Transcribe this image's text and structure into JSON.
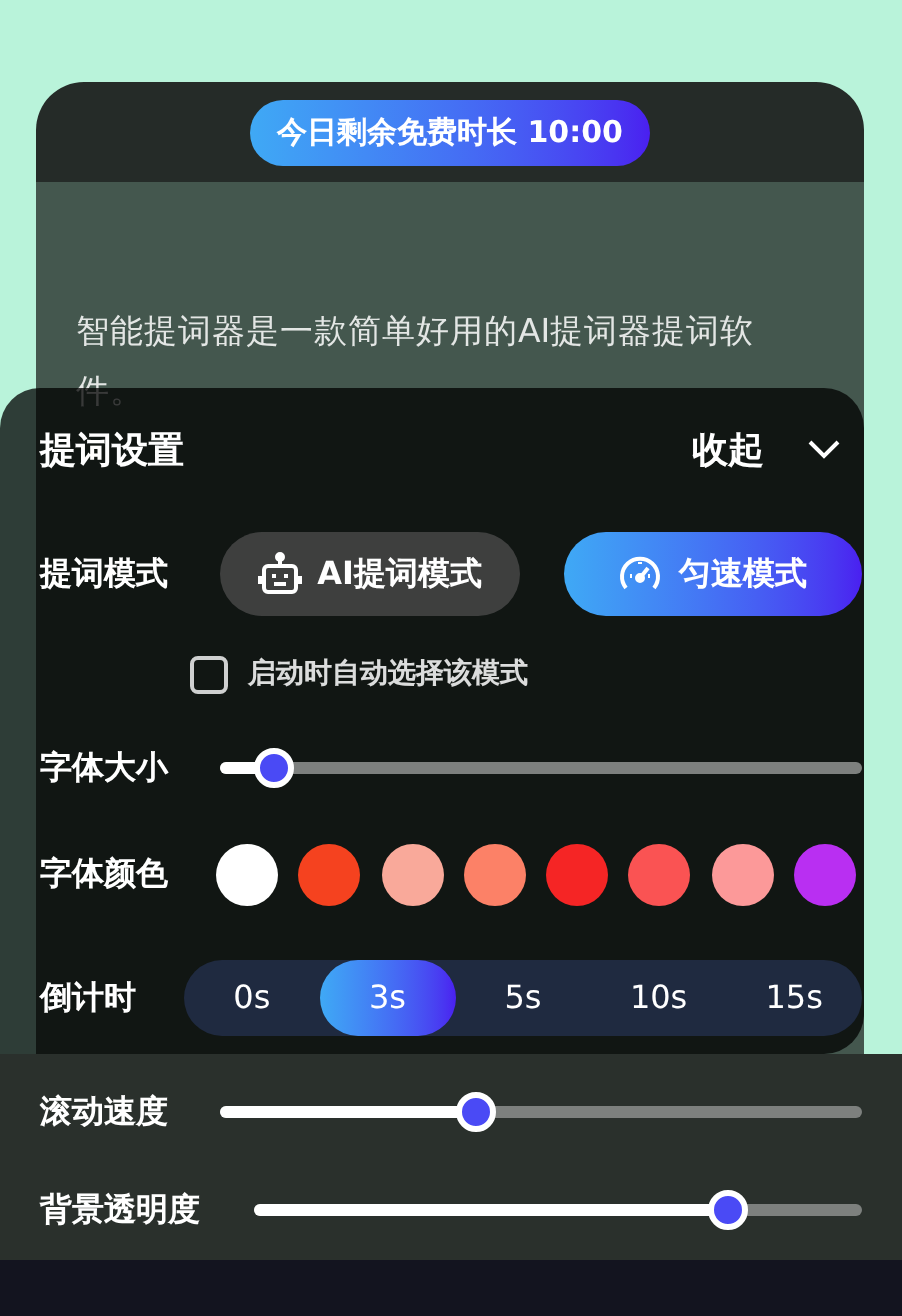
{
  "timer_badge": "今日剩余免费时长 10:00",
  "script_lines": [
    "智能提词器是一款简单好用的AI提词器提词软",
    "件。"
  ],
  "settings": {
    "title": "提词设置",
    "collapse_label": "收起",
    "mode": {
      "label": "提词模式",
      "options": [
        {
          "label": "AI提词模式",
          "kind": "robot",
          "selected": false
        },
        {
          "label": "匀速模式",
          "kind": "speed",
          "selected": true
        }
      ],
      "auto_select": {
        "label": "启动时自动选择该模式",
        "checked": false
      }
    },
    "font_size": {
      "label": "字体大小",
      "level": 0.085
    },
    "font_color": {
      "label": "字体颜色",
      "colors": [
        {
          "color": "#ffffff"
        },
        {
          "color": "#f5421f"
        },
        {
          "color": "#f9a99a"
        },
        {
          "color": "#fc8167"
        },
        {
          "color": "#f52525"
        },
        {
          "color": "#fa5353"
        },
        {
          "color": "#fc9999"
        },
        {
          "color": "#b92ff2"
        }
      ]
    },
    "countdown": {
      "label": "倒计时",
      "options": [
        {
          "label": "0s",
          "selected": false
        },
        {
          "label": "3s",
          "selected": true
        },
        {
          "label": "5s",
          "selected": false
        },
        {
          "label": "10s",
          "selected": false
        },
        {
          "label": "15s",
          "selected": false
        }
      ]
    },
    "scroll_speed": {
      "label": "滚动速度",
      "level": 0.4
    },
    "bg_opacity": {
      "label": "背景透明度",
      "level": 0.78
    }
  }
}
